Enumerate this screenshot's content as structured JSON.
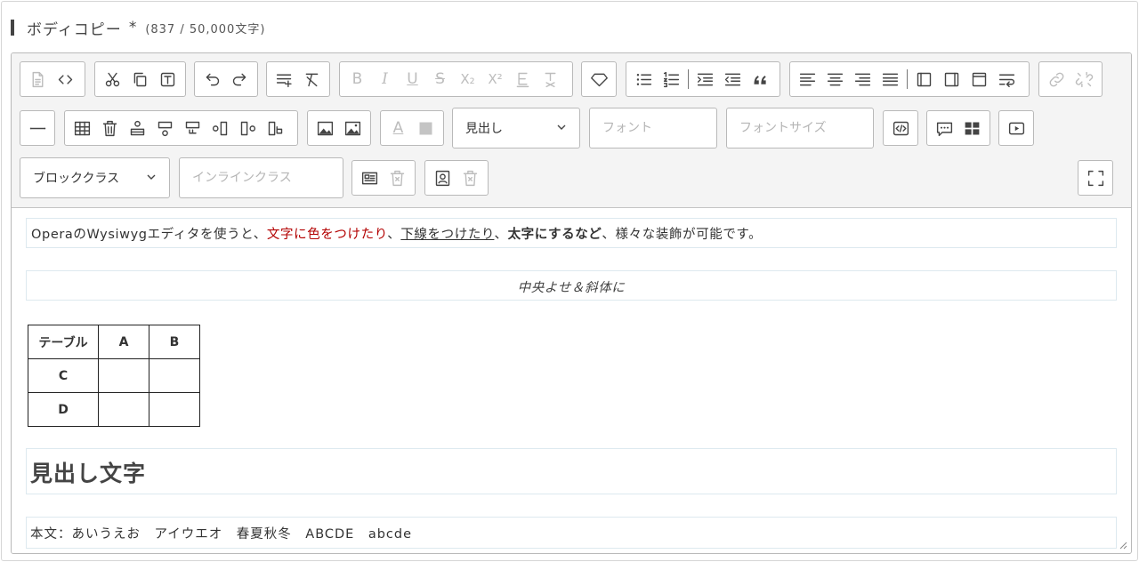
{
  "field": {
    "label": "ボディコピー",
    "required_mark": "*",
    "char_count": "(837 / 50,000文字)"
  },
  "toolbar": {
    "heading_select": "見出し",
    "font_placeholder": "フォント",
    "font_size_placeholder": "フォントサイズ",
    "block_class_select": "ブロッククラス",
    "inline_class_placeholder": "インラインクラス",
    "bold_glyph": "B",
    "italic_glyph": "I",
    "underline_glyph": "U",
    "strike_glyph": "S",
    "subscript_glyph": "X₂",
    "superscript_glyph": "X²",
    "font_color_glyph": "A"
  },
  "content": {
    "para1": {
      "t1": "OperaのWysiwygエディタを使うと、",
      "red": "文字に色をつけたり",
      "t2": "、",
      "underline": "下線をつけたり",
      "t3": "、",
      "bold": "太字にするなど",
      "t4": "、様々な装飾が可能です。"
    },
    "para2": "中央よせ＆斜体に",
    "table": {
      "header": [
        "テーブル",
        "A",
        "B"
      ],
      "rows": [
        [
          "C",
          "",
          ""
        ],
        [
          "D",
          "",
          ""
        ]
      ]
    },
    "heading": "見出し文字",
    "body": "本文：あいうえお　アイウエオ　春夏秋冬　ABCDE　abcde"
  },
  "colors": {
    "text_red": "#b30000",
    "toolbar_bg": "#f4f4f4",
    "border": "#b9b9b9"
  }
}
